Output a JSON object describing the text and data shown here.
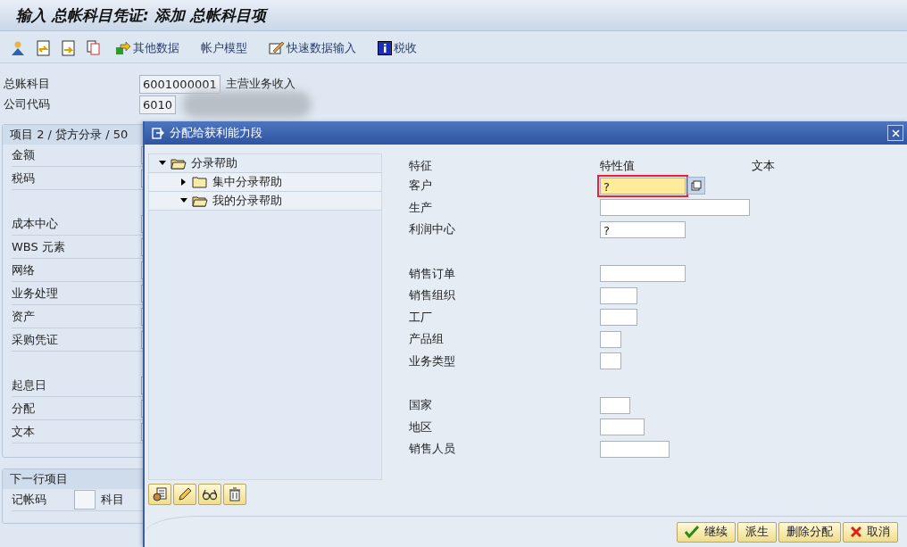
{
  "window": {
    "title": "输入 总帐科目凭证: 添加 总帐科目项"
  },
  "toolbar": [
    {
      "kind": "icon"
    },
    {
      "kind": "icon"
    },
    {
      "kind": "icon"
    },
    {
      "kind": "icon"
    },
    {
      "kind": "button",
      "label": "其他数据"
    },
    {
      "kind": "button",
      "label": "帐户模型"
    },
    {
      "kind": "button",
      "label": "快速数据输入"
    },
    {
      "kind": "button",
      "label": "税收"
    }
  ],
  "header_fields": [
    {
      "label": "总账科目",
      "value": "6001000001",
      "text": "主营业务收入"
    },
    {
      "label": "公司代码",
      "value": "6010"
    }
  ],
  "item_group": {
    "title": "项目 2 / 贷方分录 / 50",
    "rows": [
      {
        "label": "金额"
      },
      {
        "label": "税码"
      },
      {
        "kind": "gap"
      },
      {
        "label": "成本中心"
      },
      {
        "label": "WBS 元素"
      },
      {
        "label": "网络"
      },
      {
        "label": "业务处理"
      },
      {
        "label": "资产"
      },
      {
        "label": "采购凭证"
      },
      {
        "kind": "gap"
      },
      {
        "label": "起息日"
      },
      {
        "label": "分配"
      },
      {
        "label": "文本"
      }
    ]
  },
  "next_group": {
    "title": "下一行项目",
    "fields": [
      {
        "label": "记帐码"
      },
      {
        "label": "科目"
      }
    ]
  },
  "dialog": {
    "title": "分配给获利能力段",
    "tree": [
      {
        "label": "分录帮助",
        "expanded": true,
        "children": [
          {
            "label": "集中分录帮助",
            "expanded": false
          },
          {
            "label": "我的分录帮助",
            "expanded": true
          }
        ]
      }
    ],
    "columns": [
      "特征",
      "特性值",
      "文本"
    ],
    "rows": [
      {
        "label": "客户",
        "value": "?",
        "focused": true
      },
      {
        "label": "生产",
        "focused": false
      },
      {
        "label": "利润中心",
        "value": "?",
        "focused": false
      },
      {
        "kind": "gap"
      },
      {
        "label": "销售订单",
        "focused": false
      },
      {
        "label": "销售组织",
        "focused": false
      },
      {
        "label": "工厂",
        "focused": false
      },
      {
        "label": "产品组",
        "focused": false
      },
      {
        "label": "业务类型",
        "focused": false
      },
      {
        "kind": "gap"
      },
      {
        "label": "国家",
        "focused": false
      },
      {
        "label": "地区",
        "focused": false
      },
      {
        "label": "销售人员",
        "focused": false
      }
    ],
    "buttons": [
      {
        "label": "继续"
      },
      {
        "label": "派生"
      },
      {
        "label": "删除分配"
      },
      {
        "label": "取消"
      }
    ]
  }
}
